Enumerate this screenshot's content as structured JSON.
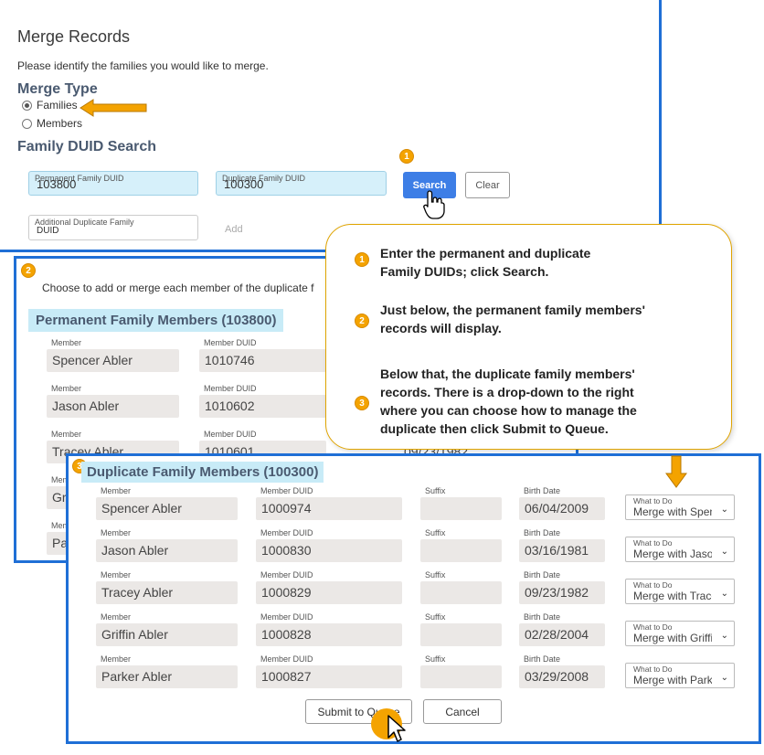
{
  "merge": {
    "title": "Merge Records",
    "intro": "Please identify the families you would like to merge.",
    "merge_type_heading": "Merge Type",
    "options": [
      {
        "label": "Families",
        "selected": true
      },
      {
        "label": "Members",
        "selected": false
      }
    ],
    "search_heading": "Family DUID Search",
    "permanent": {
      "label": "Permanent Family DUID",
      "value": "103800"
    },
    "duplicate": {
      "label": "Duplicate Family DUID",
      "value": "100300"
    },
    "additional": {
      "label": "Additional Duplicate Family",
      "value": "DUID"
    },
    "add_label": "Add",
    "search_button": "Search",
    "clear_button": "Clear"
  },
  "steps": [
    "1",
    "2",
    "3"
  ],
  "permanent_section": {
    "instruction": "Choose to add or merge each member of the duplicate f",
    "title": "Permanent Family Members (103800)",
    "member_label": "Member",
    "duid_label": "Member DUID",
    "rows": [
      {
        "member": "Spencer Abler",
        "duid": "1010746"
      },
      {
        "member": "Jason Abler",
        "duid": "1010602"
      },
      {
        "member": "Tracey Abler",
        "duid": "1010601",
        "extra": "09/23/1982"
      },
      {
        "member": "Gri",
        "duid": ""
      },
      {
        "member": "Pa",
        "duid": ""
      }
    ]
  },
  "callout": {
    "para1": [
      "Enter the permanent and duplicate",
      "Family DUIDs; click Search."
    ],
    "para2": [
      "Just below, the permanent family members'",
      "records will display."
    ],
    "para3": [
      "Below that, the duplicate family members'",
      "records. There is  a drop-down to the right",
      "where you can choose how to manage the",
      "duplicate then click Submit to Queue."
    ]
  },
  "duplicate_section": {
    "title": "Duplicate Family Members (100300)",
    "labels": {
      "member": "Member",
      "duid": "Member DUID",
      "suffix": "Suffix",
      "birth": "Birth Date",
      "todo": "What to Do"
    },
    "rows": [
      {
        "member": "Spencer Abler",
        "duid": "1000974",
        "birth": "06/04/2009",
        "todo": "Merge with Spencer Abler"
      },
      {
        "member": "Jason Abler",
        "duid": "1000830",
        "birth": "03/16/1981",
        "todo": "Merge with Jason Abler"
      },
      {
        "member": "Tracey Abler",
        "duid": "1000829",
        "birth": "09/23/1982",
        "todo": "Merge with Tracey Abler"
      },
      {
        "member": "Griffin Abler",
        "duid": "1000828",
        "birth": "02/28/2004",
        "todo": "Merge with Griffin Abler"
      },
      {
        "member": "Parker Abler",
        "duid": "1000827",
        "birth": "03/29/2008",
        "todo": "Merge with Parker Abler"
      }
    ],
    "submit_button": "Submit to Queue",
    "cancel_button": "Cancel"
  },
  "colors": {
    "border": "#1f6fd6",
    "badge": "#f4a300",
    "primary": "#3d7ee6",
    "highlight": "#c8ebf7"
  },
  "icons": {
    "arrow": "arrow-icon",
    "cursor": "cursor-icon",
    "chevron": "chevron-down-icon"
  }
}
